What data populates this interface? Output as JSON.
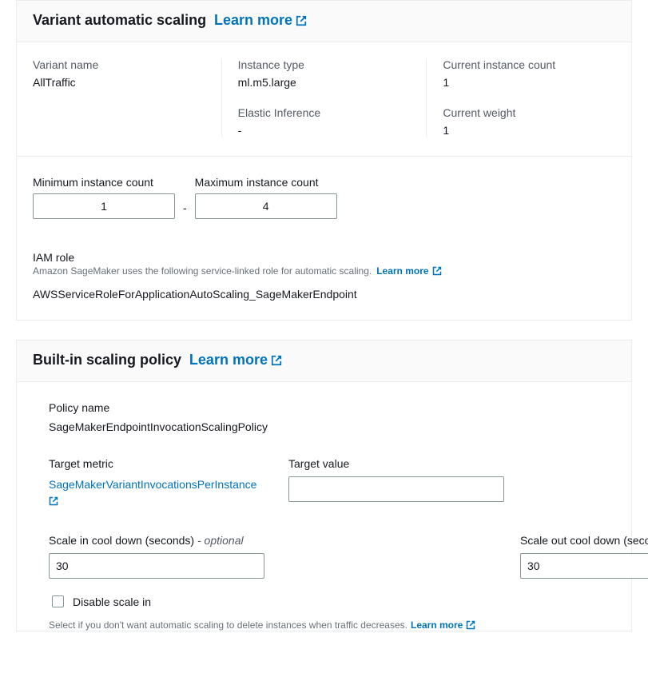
{
  "variant_panel": {
    "title": "Variant automatic scaling",
    "learn_more": "Learn more",
    "variant_name_label": "Variant name",
    "variant_name_value": "AllTraffic",
    "instance_type_label": "Instance type",
    "instance_type_value": "ml.m5.large",
    "elastic_inference_label": "Elastic Inference",
    "elastic_inference_value": "-",
    "current_instance_count_label": "Current instance count",
    "current_instance_count_value": "1",
    "current_weight_label": "Current weight",
    "current_weight_value": "1",
    "min_instance_label": "Minimum instance count",
    "min_instance_value": "1",
    "max_instance_label": "Maximum instance count",
    "max_instance_value": "4",
    "iam_role_label": "IAM role",
    "iam_role_desc": "Amazon SageMaker uses the following service-linked role for automatic scaling.",
    "iam_role_learn_more": "Learn more",
    "iam_role_value": "AWSServiceRoleForApplicationAutoScaling_SageMakerEndpoint"
  },
  "policy_panel": {
    "title": "Built-in scaling policy",
    "learn_more": "Learn more",
    "policy_name_label": "Policy name",
    "policy_name_value": "SageMakerEndpointInvocationScalingPolicy",
    "target_metric_label": "Target metric",
    "target_metric_value": "SageMakerVariantInvocationsPerInstance",
    "target_value_label": "Target value",
    "target_value_value": "",
    "scale_in_label": "Scale in cool down (seconds)",
    "scale_in_value": "30",
    "scale_out_label": "Scale out cool down (seconds)",
    "scale_out_value": "30",
    "optional_suffix": "- optional",
    "disable_scale_in_label": "Disable scale in",
    "disable_scale_in_help": "Select if you don't want automatic scaling to delete instances when traffic decreases.",
    "disable_scale_in_learn_more": "Learn more"
  }
}
